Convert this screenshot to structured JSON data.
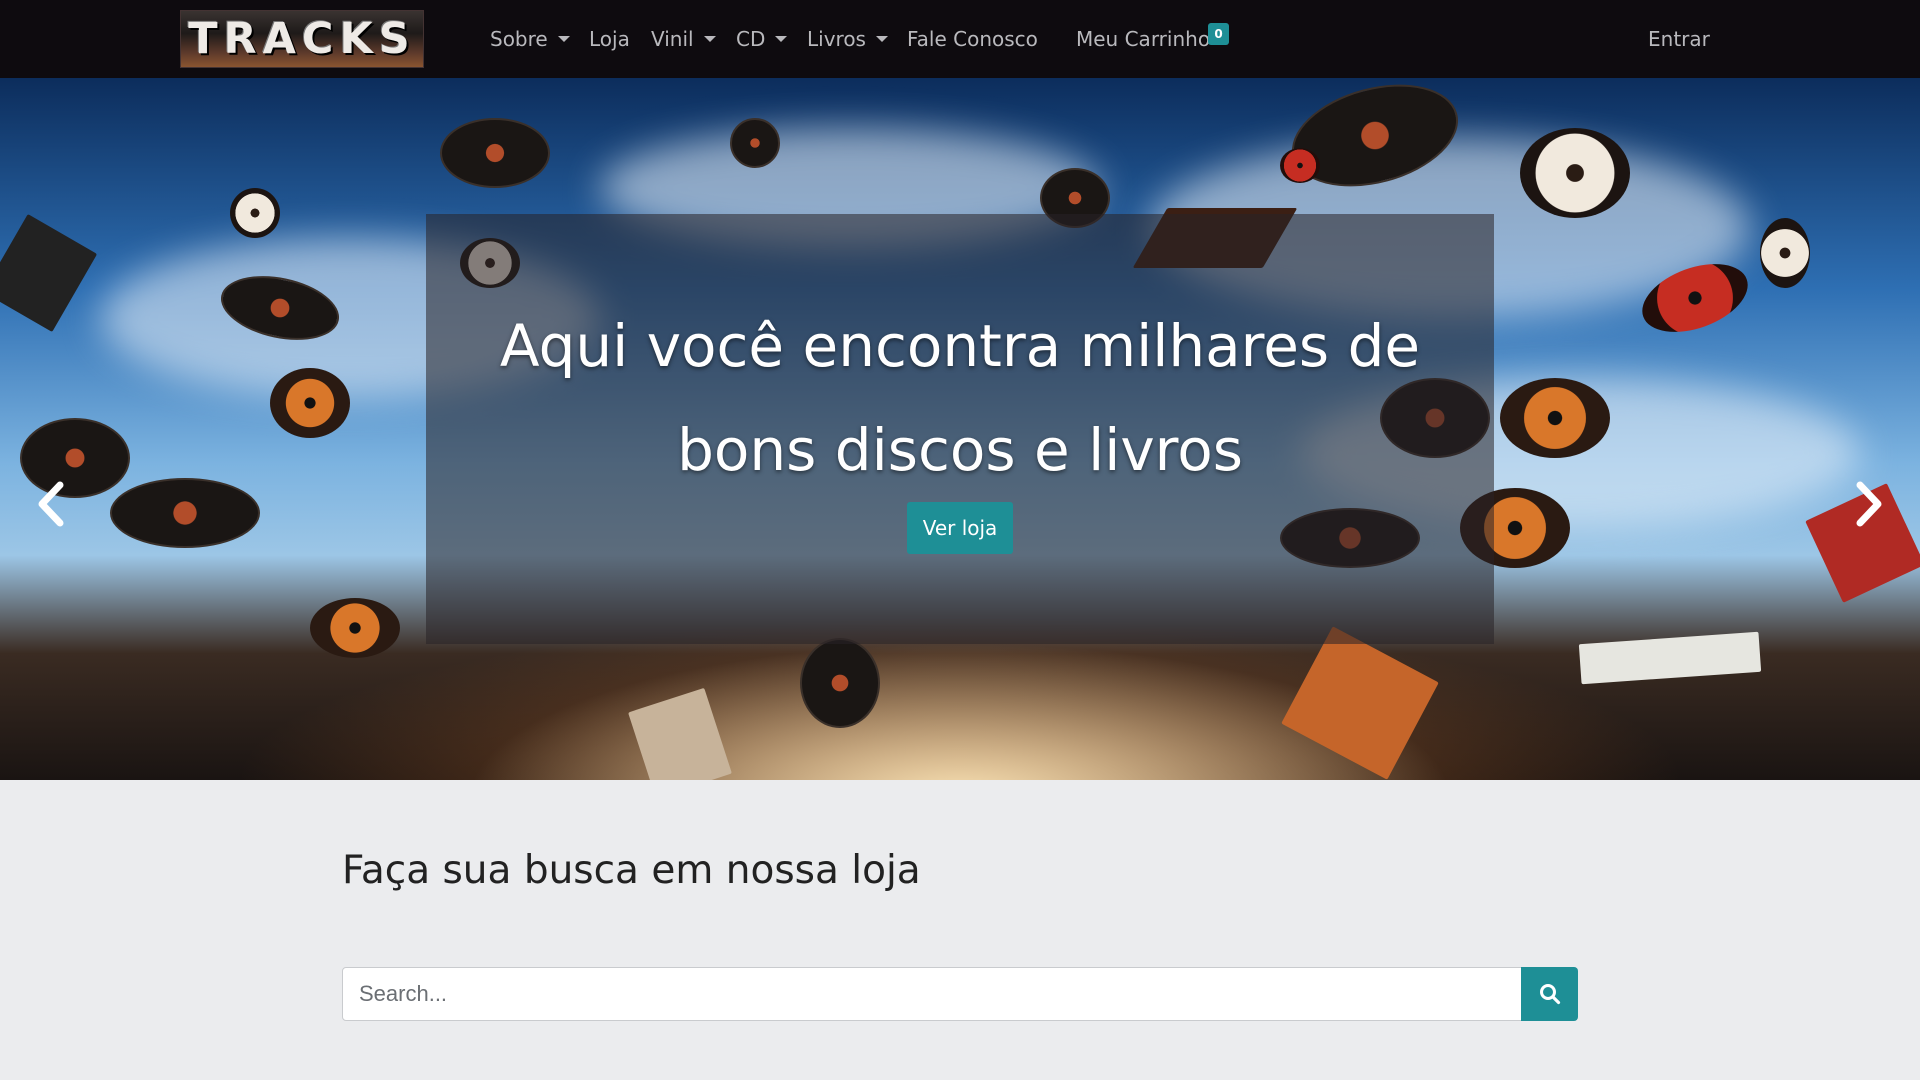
{
  "brand": {
    "logo_text": "TRACKS"
  },
  "nav": {
    "items": [
      {
        "label": "Sobre",
        "dropdown": true
      },
      {
        "label": "Loja",
        "dropdown": false
      },
      {
        "label": "Vinil",
        "dropdown": true
      },
      {
        "label": "CD",
        "dropdown": true
      },
      {
        "label": "Livros",
        "dropdown": true
      },
      {
        "label": "Fale Conosco",
        "dropdown": false
      }
    ],
    "cart": {
      "label": "Meu Carrinho",
      "count": "0"
    },
    "login": "Entrar"
  },
  "hero": {
    "title_line1": "Aqui você encontra milhares de",
    "title_line2": "bons discos e livros",
    "cta": "Ver loja",
    "prev_icon": "chevron-left-icon",
    "next_icon": "chevron-right-icon"
  },
  "search": {
    "title": "Faça sua busca em nossa loja",
    "placeholder": "Search...",
    "button_icon": "search-icon"
  },
  "colors": {
    "navbar": "#0e0b0f",
    "accent": "#1e8f96",
    "page_background": "#ebecee"
  }
}
